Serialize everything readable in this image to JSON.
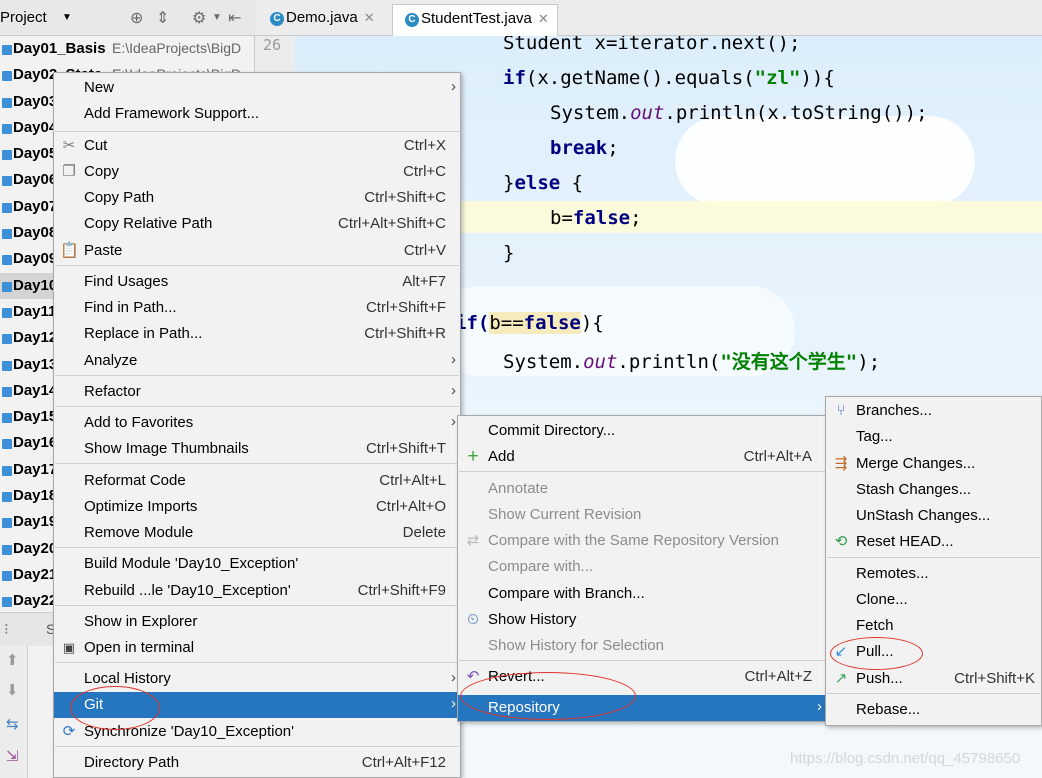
{
  "project_panel": {
    "title": "Project",
    "modules": [
      {
        "name": "Day01_Basis",
        "path": "E:\\IdeaProjects\\BigD"
      },
      {
        "name": "Day02_State",
        "path": "E:\\IdeaProjects\\BigD"
      },
      {
        "name": "Day03"
      },
      {
        "name": "Day04"
      },
      {
        "name": "Day05"
      },
      {
        "name": "Day06"
      },
      {
        "name": "Day07"
      },
      {
        "name": "Day08"
      },
      {
        "name": "Day09"
      },
      {
        "name": "Day10",
        "selected": true
      },
      {
        "name": "Day11"
      },
      {
        "name": "Day12"
      },
      {
        "name": "Day13"
      },
      {
        "name": "Day14"
      },
      {
        "name": "Day15"
      },
      {
        "name": "Day16"
      },
      {
        "name": "Day17"
      },
      {
        "name": "Day18"
      },
      {
        "name": "Day19"
      },
      {
        "name": "Day20"
      },
      {
        "name": "Day21"
      },
      {
        "name": "Day22"
      }
    ]
  },
  "tabs": [
    {
      "label": "Demo.java",
      "active": false
    },
    {
      "label": "StudentTest.java",
      "active": true
    }
  ],
  "editor": {
    "line_number": "26",
    "lines": {
      "l1": "Student x=iterator.next();",
      "l2_a": "if",
      "l2_b": "(x.getName().equals(",
      "l2_c": "\"zl\"",
      "l2_d": ")){",
      "l3_a": "System.",
      "l3_b": "out",
      "l3_c": ".println(x.toString());",
      "l4": "break",
      "l4_end": ";",
      "l5_a": "}",
      "l5_b": "else",
      "l5_c": " {",
      "l6_a": "b=",
      "l6_b": "false",
      "l6_c": ";",
      "l7": "}",
      "l8_a": "if(",
      "l8_b": "b==",
      "l8_c": "false",
      "l8_d": "){",
      "l9_a": "System.",
      "l9_b": "out",
      "l9_c": ".println(",
      "l9_d": "\"没有这个学生\"",
      "l9_e": ");"
    }
  },
  "context_menu": {
    "items": {
      "new": "New",
      "add_framework": "Add Framework Support...",
      "cut": "Cut",
      "cut_sc": "Ctrl+X",
      "copy": "Copy",
      "copy_sc": "Ctrl+C",
      "copy_path": "Copy Path",
      "copy_path_sc": "Ctrl+Shift+C",
      "copy_rel": "Copy Relative Path",
      "copy_rel_sc": "Ctrl+Alt+Shift+C",
      "paste": "Paste",
      "paste_sc": "Ctrl+V",
      "find_usages": "Find Usages",
      "find_usages_sc": "Alt+F7",
      "find_in_path": "Find in Path...",
      "find_in_path_sc": "Ctrl+Shift+F",
      "replace_in_path": "Replace in Path...",
      "replace_in_path_sc": "Ctrl+Shift+R",
      "analyze": "Analyze",
      "refactor": "Refactor",
      "add_favorites": "Add to Favorites",
      "show_thumbs": "Show Image Thumbnails",
      "show_thumbs_sc": "Ctrl+Shift+T",
      "reformat": "Reformat Code",
      "reformat_sc": "Ctrl+Alt+L",
      "optimize": "Optimize Imports",
      "optimize_sc": "Ctrl+Alt+O",
      "remove_module": "Remove Module",
      "remove_module_sc": "Delete",
      "build_module": "Build Module 'Day10_Exception'",
      "rebuild": "Rebuild ...le 'Day10_Exception'",
      "rebuild_sc": "Ctrl+Shift+F9",
      "show_explorer": "Show in Explorer",
      "open_terminal": "Open in terminal",
      "local_history": "Local History",
      "git": "Git",
      "synchronize": "Synchronize 'Day10_Exception'",
      "dir_path": "Directory Path",
      "dir_path_sc": "Ctrl+Alt+F12"
    }
  },
  "git_menu": {
    "items": {
      "commit": "Commit Directory...",
      "add": "Add",
      "add_sc": "Ctrl+Alt+A",
      "annotate": "Annotate",
      "show_current": "Show Current Revision",
      "compare_same": "Compare with the Same Repository Version",
      "compare_with": "Compare with...",
      "compare_branch": "Compare with Branch...",
      "show_history": "Show History",
      "show_history_sel": "Show History for Selection",
      "revert": "Revert...",
      "revert_sc": "Ctrl+Alt+Z",
      "repository": "Repository"
    }
  },
  "repo_menu": {
    "items": {
      "branches": "Branches...",
      "tag": "Tag...",
      "merge": "Merge Changes...",
      "stash": "Stash Changes...",
      "unstash": "UnStash Changes...",
      "reset_head": "Reset HEAD...",
      "remotes": "Remotes...",
      "clone": "Clone...",
      "fetch": "Fetch",
      "pull": "Pull...",
      "push": "Push...",
      "push_sc": "Ctrl+Shift+K",
      "rebase": "Rebase..."
    }
  },
  "watermark": "https://blog.csdn.net/qq_45798650",
  "colors": {
    "selection": "#2675bf",
    "annotation": "#e0342c"
  }
}
